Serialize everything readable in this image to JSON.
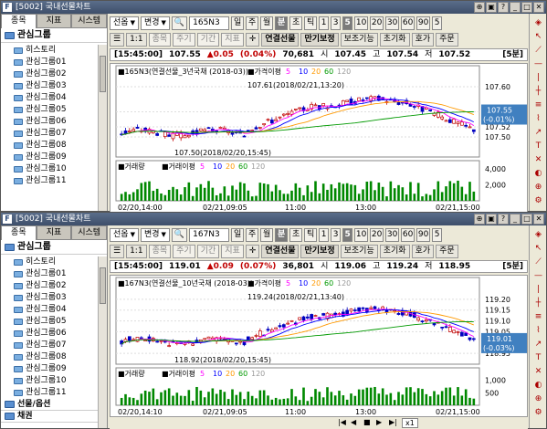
{
  "windows": [
    {
      "id": "w1",
      "title": "[5002] 국내선물차트",
      "tabs": [
        "종목",
        "지표",
        "시스템"
      ],
      "group_label": "관심그룹",
      "tree_items": [
        "히스토리",
        "관심그룹01",
        "관심그룹02",
        "관심그룹03",
        "관심그룹04",
        "관심그룹05",
        "관심그룹06",
        "관심그룹07",
        "관심그룹08",
        "관심그룹09",
        "관심그룹10",
        "관심그룹11"
      ],
      "toolbar": {
        "market": "선옵",
        "change": "변경",
        "code": "165N3",
        "periods": [
          "일",
          "주",
          "월",
          "분",
          "초",
          "틱"
        ],
        "active_period": "분",
        "intervals": [
          "1",
          "3",
          "5",
          "10",
          "20",
          "30",
          "60",
          "90",
          "5"
        ],
        "active_interval": "5"
      },
      "toolbar2": {
        "items": [
          "종목",
          "주기",
          "기간",
          "지표"
        ],
        "link_label": "연결선물",
        "expire_label": "만기보정",
        "aux_label": "보조기능",
        "reset_label": "초기화",
        "quote_label": "호가",
        "order_label": "주문"
      },
      "info": {
        "time": "[15:45:00]",
        "price": "107.55",
        "change": "▲0.05",
        "change_pct": "(0.04%)",
        "volume": "70,681",
        "open_label": "시",
        "open": "107.45",
        "high_label": "고",
        "high": "107.54",
        "low_label": "저",
        "low": "107.52",
        "period": "[5분]"
      },
      "chart_data": {
        "type": "candlestick",
        "title": "165N3(연결선물_3년국채 (2018-03))",
        "legend": {
          "ma_label": "가격이평",
          "ma_periods": [
            "5",
            "10",
            "20",
            "60",
            "120"
          ]
        },
        "ylim": [
          107.46,
          107.62
        ],
        "yticks": [
          "107.60",
          "107.55",
          "107.52",
          "107.50"
        ],
        "annotations": {
          "high": "107.61(2018/02/21,13:20)",
          "low": "107.50(2018/02/20,15:45)"
        },
        "last_price": "107.55",
        "last_change": "(-0.01%)",
        "xticks": [
          "02/20,14:00",
          "02/21,09:05",
          "11:00",
          "13:00",
          "02/21,15:00"
        ],
        "volume_title": "거래량",
        "volume_legend": {
          "ma_label": "거래이평",
          "ma_periods": [
            "5",
            "10",
            "20",
            "60",
            "120"
          ]
        },
        "volume_yticks": [
          "4,000",
          "2,000"
        ],
        "volume_max": 5000
      }
    },
    {
      "id": "w2",
      "title": "[5002] 국내선물차트",
      "tabs": [
        "종목",
        "지표",
        "시스템"
      ],
      "group_label": "관심그룹",
      "tree_items": [
        "히스토리",
        "관심그룹01",
        "관심그룹02",
        "관심그룹03",
        "관심그룹04",
        "관심그룹05",
        "관심그룹06",
        "관심그룹07",
        "관심그룹08",
        "관심그룹09",
        "관심그룹10",
        "관심그룹11"
      ],
      "tree_extra": [
        "선물/옵션",
        "채권"
      ],
      "toolbar": {
        "market": "선옵",
        "change": "변경",
        "code": "167N3",
        "periods": [
          "일",
          "주",
          "월",
          "분",
          "초",
          "틱"
        ],
        "active_period": "분",
        "intervals": [
          "1",
          "3",
          "5",
          "10",
          "20",
          "30",
          "60",
          "90",
          "5"
        ],
        "active_interval": "5"
      },
      "toolbar2": {
        "items": [
          "종목",
          "주기",
          "기간",
          "지표"
        ],
        "link_label": "연결선물",
        "expire_label": "만기보정",
        "aux_label": "보조기능",
        "reset_label": "초기화",
        "quote_label": "호가",
        "order_label": "주문"
      },
      "info": {
        "time": "[15:45:00]",
        "price": "119.01",
        "change": "▲0.09",
        "change_pct": "(0.07%)",
        "volume": "36,801",
        "open_label": "시",
        "open": "119.06",
        "high_label": "고",
        "high": "119.24",
        "low_label": "저",
        "low": "118.95",
        "period": "[5분]"
      },
      "chart_data": {
        "type": "candlestick",
        "title": "167N3(연결선물_10년국채 (2018-03))",
        "legend": {
          "ma_label": "가격이평",
          "ma_periods": [
            "5",
            "10",
            "20",
            "60",
            "120"
          ]
        },
        "ylim": [
          118.9,
          119.25
        ],
        "yticks": [
          "119.20",
          "119.15",
          "119.10",
          "119.05",
          "118.95"
        ],
        "annotations": {
          "high": "119.24(2018/02/21,13:40)",
          "low": "118.92(2018/02/20,15:45)"
        },
        "last_price": "119.01",
        "last_change": "(-0.03%)",
        "xticks": [
          "02/20,14:10",
          "02/21,09:05",
          "11:00",
          "13:00",
          "02/21,15:00"
        ],
        "volume_title": "거래량",
        "volume_legend": {
          "ma_label": "거래이평",
          "ma_periods": [
            "5",
            "10",
            "20",
            "60",
            "120"
          ]
        },
        "volume_yticks": [
          "1,000",
          "500"
        ],
        "volume_max": 1500
      }
    }
  ],
  "statusbar": {
    "zoom": "x1"
  },
  "colors": {
    "up": "#c00000",
    "down": "#0000c0",
    "ma5": "#ff00ff",
    "ma10": "#0000ff",
    "ma20": "#ff9900",
    "ma60": "#009900",
    "ma120": "#999999",
    "volume": "#008800",
    "highlight": "#4080c0"
  }
}
